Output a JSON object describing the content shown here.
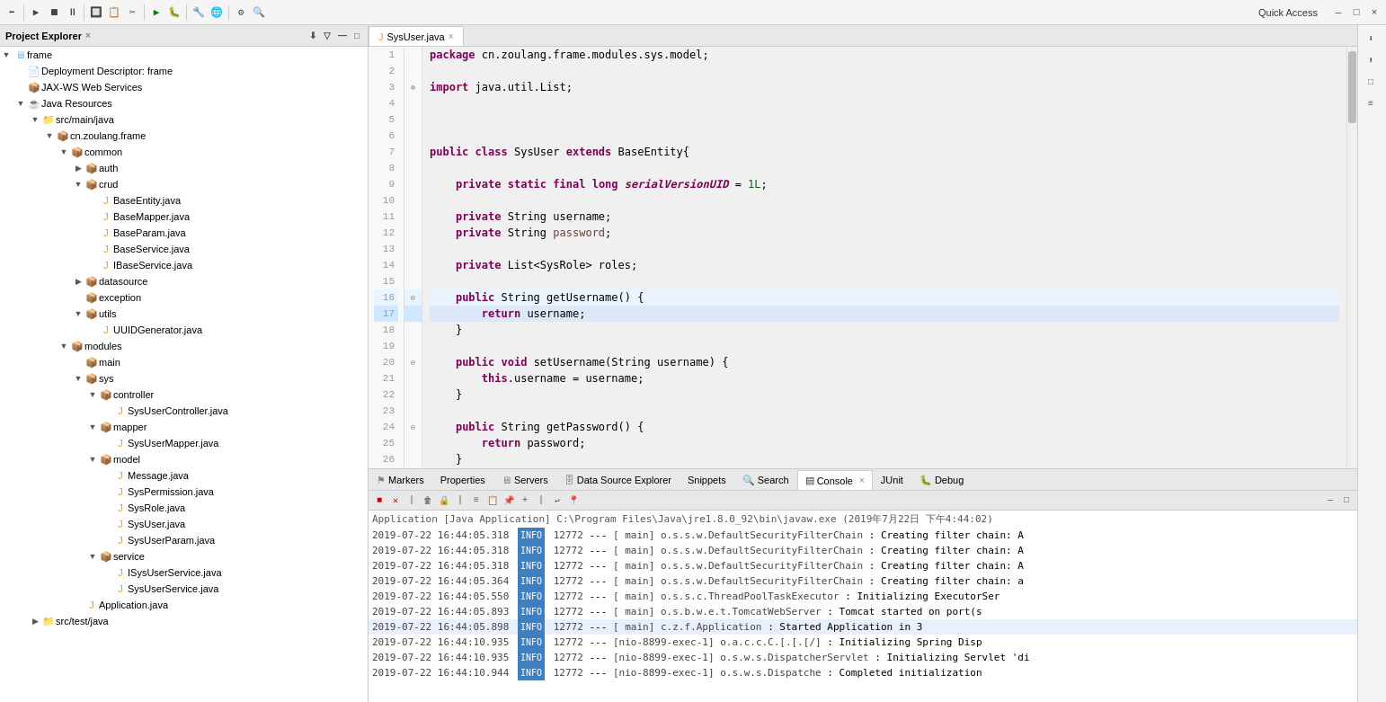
{
  "toolbar": {
    "quick_access_label": "Quick Access"
  },
  "left_panel": {
    "title": "Project Explorer",
    "close_icon": "×",
    "tree": [
      {
        "id": "frame",
        "label": "frame",
        "indent": 0,
        "type": "project",
        "arrow": "▼"
      },
      {
        "id": "deployment",
        "label": "Deployment Descriptor: frame",
        "indent": 1,
        "type": "desc",
        "arrow": ""
      },
      {
        "id": "jaxws",
        "label": "JAX-WS Web Services",
        "indent": 1,
        "type": "package",
        "arrow": ""
      },
      {
        "id": "java-resources",
        "label": "Java Resources",
        "indent": 1,
        "type": "package",
        "arrow": "▼"
      },
      {
        "id": "src-main-java",
        "label": "src/main/java",
        "indent": 2,
        "type": "src",
        "arrow": "▼"
      },
      {
        "id": "cn-zoulang-frame",
        "label": "cn.zoulang.frame",
        "indent": 3,
        "type": "package",
        "arrow": "▼"
      },
      {
        "id": "common",
        "label": "common",
        "indent": 4,
        "type": "folder",
        "arrow": "▼"
      },
      {
        "id": "auth",
        "label": "auth",
        "indent": 5,
        "type": "folder",
        "arrow": "▶"
      },
      {
        "id": "crud",
        "label": "crud",
        "indent": 5,
        "type": "folder",
        "arrow": "▼"
      },
      {
        "id": "BaseEntity",
        "label": "BaseEntity.java",
        "indent": 6,
        "type": "java",
        "arrow": ""
      },
      {
        "id": "BaseMapper",
        "label": "BaseMapper.java",
        "indent": 6,
        "type": "java",
        "arrow": ""
      },
      {
        "id": "BaseParam",
        "label": "BaseParam.java",
        "indent": 6,
        "type": "java",
        "arrow": ""
      },
      {
        "id": "BaseService",
        "label": "BaseService.java",
        "indent": 6,
        "type": "java",
        "arrow": ""
      },
      {
        "id": "IBaseService",
        "label": "IBaseService.java",
        "indent": 6,
        "type": "java",
        "arrow": ""
      },
      {
        "id": "datasource",
        "label": "datasource",
        "indent": 5,
        "type": "folder",
        "arrow": "▶"
      },
      {
        "id": "exception",
        "label": "exception",
        "indent": 5,
        "type": "folder",
        "arrow": ""
      },
      {
        "id": "utils",
        "label": "utils",
        "indent": 5,
        "type": "folder",
        "arrow": "▼"
      },
      {
        "id": "UUIDGenerator",
        "label": "UUIDGenerator.java",
        "indent": 6,
        "type": "java",
        "arrow": ""
      },
      {
        "id": "modules",
        "label": "modules",
        "indent": 4,
        "type": "folder",
        "arrow": "▼"
      },
      {
        "id": "main",
        "label": "main",
        "indent": 5,
        "type": "folder",
        "arrow": ""
      },
      {
        "id": "sys",
        "label": "sys",
        "indent": 5,
        "type": "folder",
        "arrow": "▼"
      },
      {
        "id": "controller",
        "label": "controller",
        "indent": 6,
        "type": "folder",
        "arrow": "▼"
      },
      {
        "id": "SysUserController",
        "label": "SysUserController.java",
        "indent": 7,
        "type": "java",
        "arrow": ""
      },
      {
        "id": "mapper",
        "label": "mapper",
        "indent": 6,
        "type": "folder",
        "arrow": "▼"
      },
      {
        "id": "SysUserMapper",
        "label": "SysUserMapper.java",
        "indent": 7,
        "type": "java",
        "arrow": ""
      },
      {
        "id": "model",
        "label": "model",
        "indent": 6,
        "type": "folder",
        "arrow": "▼"
      },
      {
        "id": "Message",
        "label": "Message.java",
        "indent": 7,
        "type": "java",
        "arrow": ""
      },
      {
        "id": "SysPermission",
        "label": "SysPermission.java",
        "indent": 7,
        "type": "java",
        "arrow": ""
      },
      {
        "id": "SysRole",
        "label": "SysRole.java",
        "indent": 7,
        "type": "java",
        "arrow": ""
      },
      {
        "id": "SysUser",
        "label": "SysUser.java",
        "indent": 7,
        "type": "java",
        "arrow": ""
      },
      {
        "id": "SysUserParam",
        "label": "SysUserParam.java",
        "indent": 7,
        "type": "java",
        "arrow": ""
      },
      {
        "id": "service",
        "label": "service",
        "indent": 6,
        "type": "folder",
        "arrow": "▼"
      },
      {
        "id": "ISysUserService",
        "label": "ISysUserService.java",
        "indent": 7,
        "type": "java",
        "arrow": ""
      },
      {
        "id": "SysUserService",
        "label": "SysUserService.java",
        "indent": 7,
        "type": "java",
        "arrow": ""
      },
      {
        "id": "Application",
        "label": "Application.java",
        "indent": 5,
        "type": "java",
        "arrow": ""
      },
      {
        "id": "src-test-java",
        "label": "src/test/java",
        "indent": 2,
        "type": "src",
        "arrow": "▶"
      }
    ]
  },
  "editor": {
    "tab_label": "SysUser.java",
    "tab_close": "×",
    "lines": [
      {
        "num": 1,
        "code": "package cn.zoulang.frame.modules.sys.model;",
        "tokens": [
          {
            "t": "kw",
            "v": "package"
          },
          {
            "t": "",
            "v": " cn.zoulang.frame.modules.sys.model;"
          }
        ]
      },
      {
        "num": 2,
        "code": "",
        "tokens": []
      },
      {
        "num": 3,
        "code": "import java.util.List;",
        "tokens": [
          {
            "t": "kw",
            "v": "import"
          },
          {
            "t": "",
            "v": " java.util.List;"
          }
        ],
        "fold": true
      },
      {
        "num": 4,
        "code": "",
        "tokens": []
      },
      {
        "num": 5,
        "code": "",
        "tokens": []
      },
      {
        "num": 6,
        "code": "",
        "tokens": []
      },
      {
        "num": 7,
        "code": "public class SysUser extends BaseEntity{",
        "tokens": [
          {
            "t": "kw",
            "v": "public"
          },
          {
            "t": "",
            "v": " "
          },
          {
            "t": "kw",
            "v": "class"
          },
          {
            "t": "",
            "v": " SysUser "
          },
          {
            "t": "kw",
            "v": "extends"
          },
          {
            "t": "",
            "v": " BaseEntity{"
          }
        ]
      },
      {
        "num": 8,
        "code": "",
        "tokens": []
      },
      {
        "num": 9,
        "code": "    private static final long serialVersionUID = 1L;",
        "tokens": [
          {
            "t": "",
            "v": "    "
          },
          {
            "t": "kw",
            "v": "private"
          },
          {
            "t": "",
            "v": " "
          },
          {
            "t": "kw",
            "v": "static"
          },
          {
            "t": "",
            "v": " "
          },
          {
            "t": "kw",
            "v": "final"
          },
          {
            "t": "",
            "v": " "
          },
          {
            "t": "kw",
            "v": "long"
          },
          {
            "t": "",
            "v": " "
          },
          {
            "t": "kw2",
            "v": "serialVersionUID"
          },
          {
            "t": "",
            "v": " = "
          },
          {
            "t": "num",
            "v": "1L"
          },
          {
            "t": "",
            "v": ";"
          }
        ]
      },
      {
        "num": 10,
        "code": "",
        "tokens": []
      },
      {
        "num": 11,
        "code": "    private String username;",
        "tokens": [
          {
            "t": "",
            "v": "    "
          },
          {
            "t": "kw",
            "v": "private"
          },
          {
            "t": "",
            "v": " String username;"
          }
        ]
      },
      {
        "num": 12,
        "code": "    private String password;",
        "tokens": [
          {
            "t": "",
            "v": "    "
          },
          {
            "t": "kw",
            "v": "private"
          },
          {
            "t": "",
            "v": " String "
          },
          {
            "t": "var-name",
            "v": "password"
          },
          {
            "t": "",
            "v": ";"
          }
        ]
      },
      {
        "num": 13,
        "code": "",
        "tokens": []
      },
      {
        "num": 14,
        "code": "    private List<SysRole> roles;",
        "tokens": [
          {
            "t": "",
            "v": "    "
          },
          {
            "t": "kw",
            "v": "private"
          },
          {
            "t": "",
            "v": " List<SysRole> roles;"
          }
        ]
      },
      {
        "num": 15,
        "code": "",
        "tokens": []
      },
      {
        "num": 16,
        "code": "    public String getUsername() {",
        "tokens": [
          {
            "t": "",
            "v": "    "
          },
          {
            "t": "kw",
            "v": "public"
          },
          {
            "t": "",
            "v": " String getUsername() {"
          }
        ],
        "fold": true,
        "highlight": true
      },
      {
        "num": 17,
        "code": "        return username;",
        "tokens": [
          {
            "t": "",
            "v": "        "
          },
          {
            "t": "kw",
            "v": "return"
          },
          {
            "t": "",
            "v": " username;"
          }
        ],
        "selected": true
      },
      {
        "num": 18,
        "code": "    }",
        "tokens": [
          {
            "t": "",
            "v": "    }"
          }
        ]
      },
      {
        "num": 19,
        "code": "",
        "tokens": []
      },
      {
        "num": 20,
        "code": "    public void setUsername(String username) {",
        "tokens": [
          {
            "t": "",
            "v": "    "
          },
          {
            "t": "kw",
            "v": "public"
          },
          {
            "t": "",
            "v": " "
          },
          {
            "t": "kw",
            "v": "void"
          },
          {
            "t": "",
            "v": " setUsername(String username) {"
          }
        ],
        "fold": true
      },
      {
        "num": 21,
        "code": "        this.username = username;",
        "tokens": [
          {
            "t": "",
            "v": "        "
          },
          {
            "t": "kw",
            "v": "this"
          },
          {
            "t": "",
            "v": ".username = username;"
          }
        ]
      },
      {
        "num": 22,
        "code": "    }",
        "tokens": [
          {
            "t": "",
            "v": "    }"
          }
        ]
      },
      {
        "num": 23,
        "code": "",
        "tokens": []
      },
      {
        "num": 24,
        "code": "    public String getPassword() {",
        "tokens": [
          {
            "t": "",
            "v": "    "
          },
          {
            "t": "kw",
            "v": "public"
          },
          {
            "t": "",
            "v": " String getPassword() {"
          }
        ],
        "fold": true
      },
      {
        "num": 25,
        "code": "        return password;",
        "tokens": [
          {
            "t": "",
            "v": "        "
          },
          {
            "t": "kw",
            "v": "return"
          },
          {
            "t": "",
            "v": " password;"
          }
        ]
      },
      {
        "num": 26,
        "code": "    }",
        "tokens": [
          {
            "t": "",
            "v": "    }"
          }
        ]
      }
    ]
  },
  "bottom_panel": {
    "tabs": [
      {
        "id": "markers",
        "label": "Markers",
        "active": false
      },
      {
        "id": "properties",
        "label": "Properties",
        "active": false
      },
      {
        "id": "servers",
        "label": "Servers",
        "active": false
      },
      {
        "id": "datasource",
        "label": "Data Source Explorer",
        "active": false
      },
      {
        "id": "snippets",
        "label": "Snippets",
        "active": false
      },
      {
        "id": "search",
        "label": "Search",
        "active": false
      },
      {
        "id": "console",
        "label": "Console",
        "active": true
      },
      {
        "id": "junit",
        "label": "JUnit",
        "active": false
      },
      {
        "id": "debug",
        "label": "Debug",
        "active": false
      }
    ],
    "console_header": "Application [Java Application] C:\\Program Files\\Java\\jre1.8.0_92\\bin\\javaw.exe (2019年7月22日 下午4:44:02)",
    "log_lines": [
      {
        "date": "2019-07-22  16:44:05.318",
        "level": "INFO",
        "num": "12772",
        "sep": "---",
        "thread": "[           main]",
        "class": "o.s.s.w.DefaultSecurityFilterChain",
        "msg": ": Creating filter chain: A"
      },
      {
        "date": "2019-07-22  16:44:05.318",
        "level": "INFO",
        "num": "12772",
        "sep": "---",
        "thread": "[           main]",
        "class": "o.s.s.w.DefaultSecurityFilterChain",
        "msg": ": Creating filter chain: A"
      },
      {
        "date": "2019-07-22  16:44:05.318",
        "level": "INFO",
        "num": "12772",
        "sep": "---",
        "thread": "[           main]",
        "class": "o.s.s.w.DefaultSecurityFilterChain",
        "msg": ": Creating filter chain: A"
      },
      {
        "date": "2019-07-22  16:44:05.364",
        "level": "INFO",
        "num": "12772",
        "sep": "---",
        "thread": "[           main]",
        "class": "o.s.s.w.DefaultSecurityFilterChain",
        "msg": ": Creating filter chain: a"
      },
      {
        "date": "2019-07-22  16:44:05.550",
        "level": "INFO",
        "num": "12772",
        "sep": "---",
        "thread": "[           main]",
        "class": "o.s.s.c.ThreadPoolTaskExecutor",
        "msg": ": Initializing ExecutorSer"
      },
      {
        "date": "2019-07-22  16:44:05.893",
        "level": "INFO",
        "num": "12772",
        "sep": "---",
        "thread": "[           main]",
        "class": "o.s.b.w.e.t.TomcatWebServer",
        "msg": ": Tomcat started on port(s"
      },
      {
        "date": "2019-07-22  16:44:05.898",
        "level": "INFO",
        "num": "12772",
        "sep": "---",
        "thread": "[           main]",
        "class": "c.z.f.Application",
        "msg": ": Started Application in 3",
        "highlight": true
      },
      {
        "date": "2019-07-22  16:44:10.935",
        "level": "INFO",
        "num": "12772",
        "sep": "---",
        "thread": "[nio-8899-exec-1]",
        "class": "o.a.c.c.C.[.[.[/]",
        "msg": ": Initializing Spring Disp"
      },
      {
        "date": "2019-07-22  16:44:10.935",
        "level": "INFO",
        "num": "12772",
        "sep": "---",
        "thread": "[nio-8899-exec-1]",
        "class": "o.s.w.s.DispatcherServlet",
        "msg": ": Initializing Servlet 'di"
      },
      {
        "date": "2019-07-22  16:44:10.944",
        "level": "INFO",
        "num": "12772",
        "sep": "---",
        "thread": "[nio-8899-exec-1]",
        "class": "o.s.w.s.Dispatche",
        "msg": ": Completed initialization"
      }
    ]
  }
}
